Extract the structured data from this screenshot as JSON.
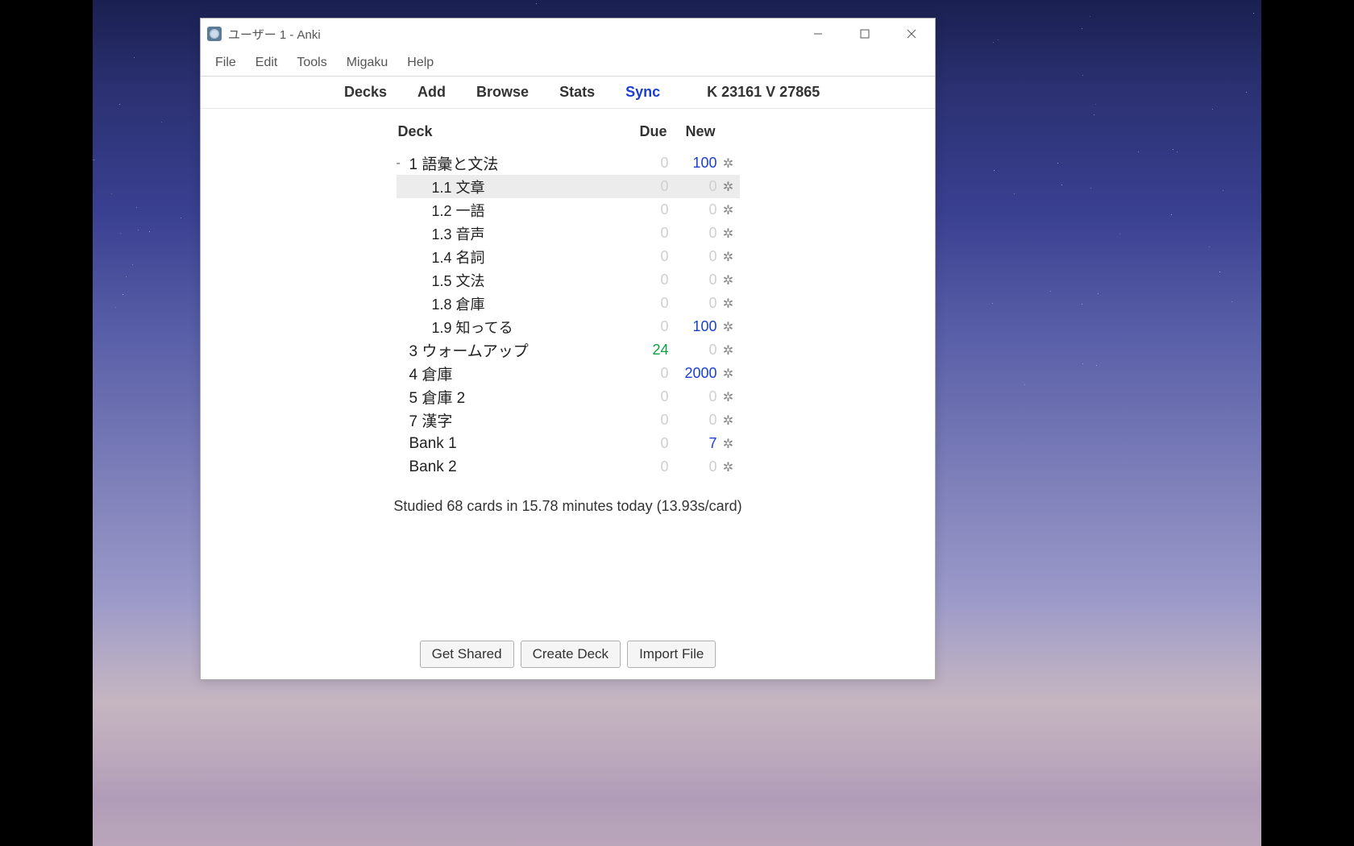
{
  "window": {
    "title": "ユーザー 1 - Anki"
  },
  "menubar": {
    "file": "File",
    "edit": "Edit",
    "tools": "Tools",
    "migaku": "Migaku",
    "help": "Help"
  },
  "toolbar": {
    "decks": "Decks",
    "add": "Add",
    "browse": "Browse",
    "stats": "Stats",
    "sync": "Sync",
    "counters": "K 23161 V 27865"
  },
  "deck_table": {
    "header_deck": "Deck",
    "header_due": "Due",
    "header_new": "New",
    "rows": [
      {
        "name": "1 語彙と文法",
        "due": "0",
        "new": "100",
        "indent": 0,
        "expanded": true,
        "due_class": "zero",
        "new_class": "blue-val"
      },
      {
        "name": "1.1 文章",
        "due": "0",
        "new": "0",
        "indent": 1,
        "selected": true,
        "due_class": "zero",
        "new_class": "zero"
      },
      {
        "name": "1.2 一語",
        "due": "0",
        "new": "0",
        "indent": 1,
        "due_class": "zero",
        "new_class": "zero"
      },
      {
        "name": "1.3 音声",
        "due": "0",
        "new": "0",
        "indent": 1,
        "due_class": "zero",
        "new_class": "zero"
      },
      {
        "name": "1.4 名詞",
        "due": "0",
        "new": "0",
        "indent": 1,
        "due_class": "zero",
        "new_class": "zero"
      },
      {
        "name": "1.5 文法",
        "due": "0",
        "new": "0",
        "indent": 1,
        "due_class": "zero",
        "new_class": "zero"
      },
      {
        "name": "1.8 倉庫",
        "due": "0",
        "new": "0",
        "indent": 1,
        "due_class": "zero",
        "new_class": "zero"
      },
      {
        "name": "1.9 知ってる",
        "due": "0",
        "new": "100",
        "indent": 1,
        "due_class": "zero",
        "new_class": "blue-val"
      },
      {
        "name": "3 ウォームアップ",
        "due": "24",
        "new": "0",
        "indent": 0,
        "due_class": "green-val",
        "new_class": "zero"
      },
      {
        "name": "4 倉庫",
        "due": "0",
        "new": "2000",
        "indent": 0,
        "due_class": "zero",
        "new_class": "blue-val"
      },
      {
        "name": "5 倉庫 2",
        "due": "0",
        "new": "0",
        "indent": 0,
        "due_class": "zero",
        "new_class": "zero"
      },
      {
        "name": "7 漢字",
        "due": "0",
        "new": "0",
        "indent": 0,
        "due_class": "zero",
        "new_class": "zero"
      },
      {
        "name": "Bank 1",
        "due": "0",
        "new": "7",
        "indent": 0,
        "due_class": "zero",
        "new_class": "blue-val"
      },
      {
        "name": "Bank 2",
        "due": "0",
        "new": "0",
        "indent": 0,
        "due_class": "zero",
        "new_class": "zero"
      }
    ]
  },
  "study_status": "Studied 68 cards in 15.78 minutes today (13.93s/card)",
  "bottom": {
    "get_shared": "Get Shared",
    "create_deck": "Create Deck",
    "import_file": "Import File"
  }
}
